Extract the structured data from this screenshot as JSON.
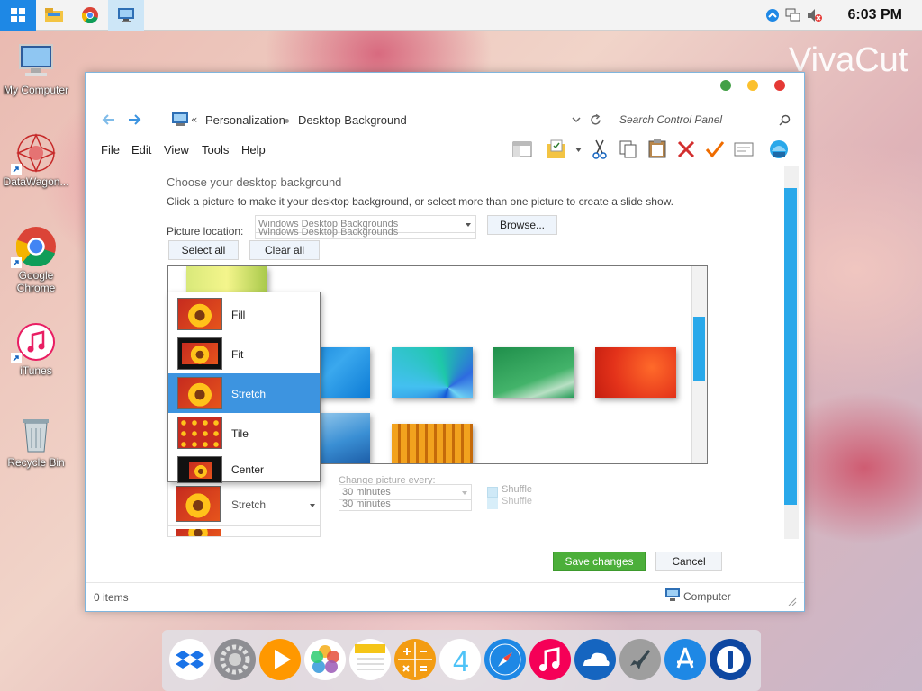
{
  "taskbar": {
    "clock": "6:03 PM",
    "items": [
      "start-icon",
      "file-explorer-icon",
      "chrome-icon",
      "control-panel-icon"
    ]
  },
  "desktop": {
    "icons": [
      {
        "label": "My Computer"
      },
      {
        "label": "DataWagon..."
      },
      {
        "label": "Google Chrome"
      },
      {
        "label": "iTunes"
      },
      {
        "label": "Recycle Bin"
      }
    ],
    "watermark": "VivaCut"
  },
  "window": {
    "breadcrumb": {
      "prefix": "«",
      "items": [
        "Personalization",
        "Desktop Background"
      ]
    },
    "search_placeholder": "Search Control Panel",
    "menu": [
      "File",
      "Edit",
      "View",
      "Tools",
      "Help"
    ],
    "heading": "Choose your desktop background",
    "instructions": "Click a picture to make it your desktop background, or select more than one picture to create a slide show.",
    "picture_location_label": "Picture location:",
    "picture_location_value": "Windows Desktop Backgrounds",
    "browse_label": "Browse...",
    "select_all_label": "Select all",
    "clear_all_label": "Clear all",
    "picture_position": {
      "options": [
        "Fill",
        "Fit",
        "Stretch",
        "Tile",
        "Center"
      ],
      "selected": "Stretch"
    },
    "change_picture_label": "Change picture every:",
    "interval_value": "30 minutes",
    "shuffle_label": "Shuffle",
    "save_label": "Save changes",
    "cancel_label": "Cancel",
    "status_items": "0 items",
    "status_computer": "Computer"
  },
  "colors": {
    "accent": "#3d94e0",
    "save_green": "#4caf3a",
    "scrollbar": "#29a8ea",
    "titlebar_close": "#e53935",
    "titlebar_min": "#fbc02d",
    "titlebar_max": "#43a047"
  },
  "dock": {
    "apps": [
      "dropbox-icon",
      "settings-icon",
      "infuse-icon",
      "photos-icon",
      "notes-icon",
      "calculator-icon",
      "four-icon",
      "safari-icon",
      "music-icon",
      "onedrive-icon",
      "launchpad-icon",
      "app-store-icon",
      "1password-icon"
    ]
  }
}
